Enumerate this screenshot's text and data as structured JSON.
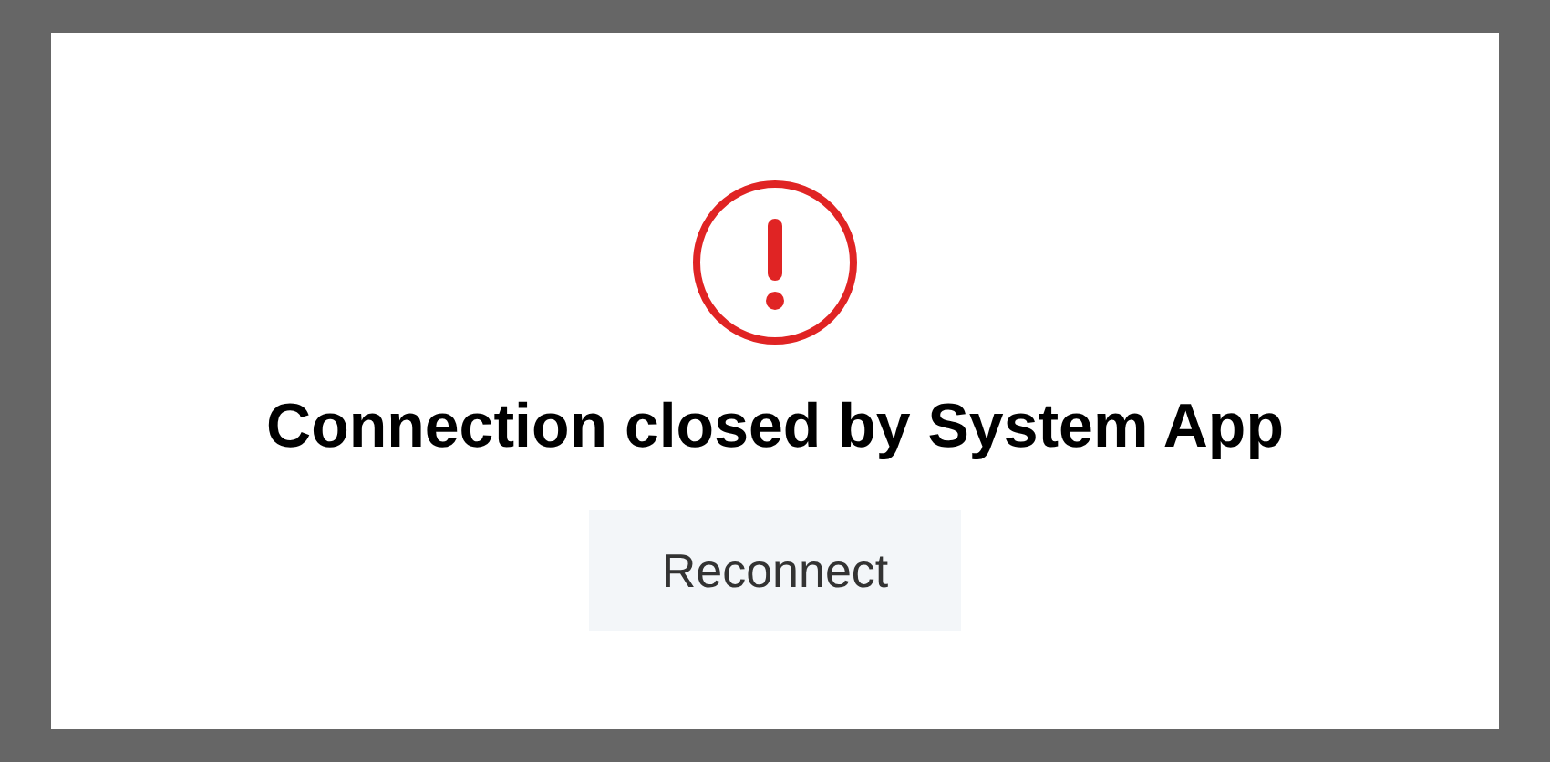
{
  "dialog": {
    "title": "Connection closed by System App",
    "button": "Reconnect"
  }
}
